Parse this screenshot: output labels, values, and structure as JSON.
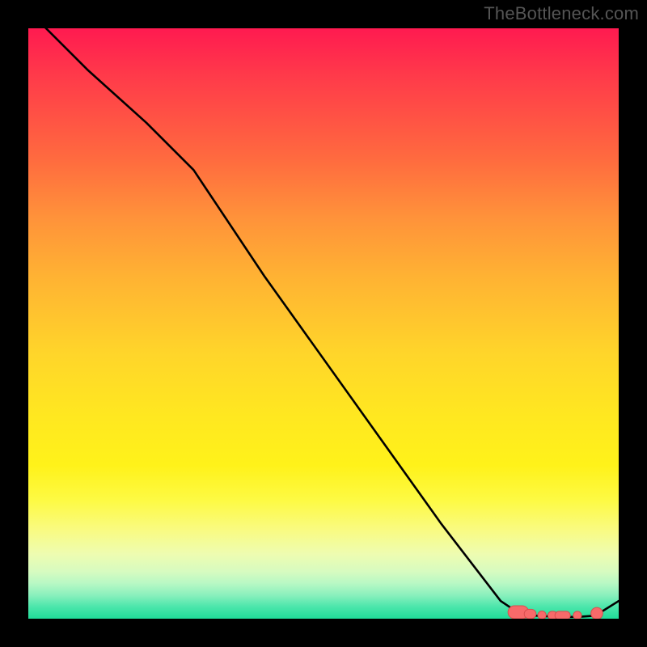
{
  "watermark": "TheBottleneck.com",
  "colors": {
    "curve_stroke": "#000000",
    "marker_fill": "#f76a6a",
    "marker_stroke": "#d94f4f",
    "gradient_top": "#ff1a50",
    "gradient_bottom": "#1fdc99",
    "background": "#000000"
  },
  "chart_data": {
    "type": "line",
    "title": "",
    "xlabel": "",
    "ylabel": "",
    "xlim": [
      0,
      100
    ],
    "ylim": [
      0,
      100
    ],
    "grid": false,
    "legend": false,
    "annotations": [],
    "series": [
      {
        "name": "bottleneck-curve",
        "x": [
          0,
          10,
          20,
          28,
          40,
          55,
          70,
          80,
          83,
          86,
          90,
          93,
          96,
          100
        ],
        "y": [
          103,
          93,
          84,
          76,
          58,
          37,
          16,
          3,
          1,
          0.5,
          0.3,
          0.3,
          0.5,
          3
        ]
      }
    ],
    "markers": [
      {
        "shape": "round",
        "cx": 83.0,
        "cy": 1.1,
        "w": 3.5,
        "h": 2.2
      },
      {
        "shape": "round",
        "cx": 85.0,
        "cy": 0.8,
        "w": 2.0,
        "h": 1.6
      },
      {
        "shape": "round",
        "cx": 87.0,
        "cy": 0.6,
        "w": 1.4,
        "h": 1.4
      },
      {
        "shape": "round",
        "cx": 88.8,
        "cy": 0.55,
        "w": 1.6,
        "h": 1.4
      },
      {
        "shape": "round",
        "cx": 90.5,
        "cy": 0.55,
        "w": 2.6,
        "h": 1.4
      },
      {
        "shape": "round",
        "cx": 93.0,
        "cy": 0.55,
        "w": 1.4,
        "h": 1.4
      },
      {
        "shape": "circle",
        "cx": 96.3,
        "cy": 0.9,
        "r": 1.0
      }
    ]
  }
}
